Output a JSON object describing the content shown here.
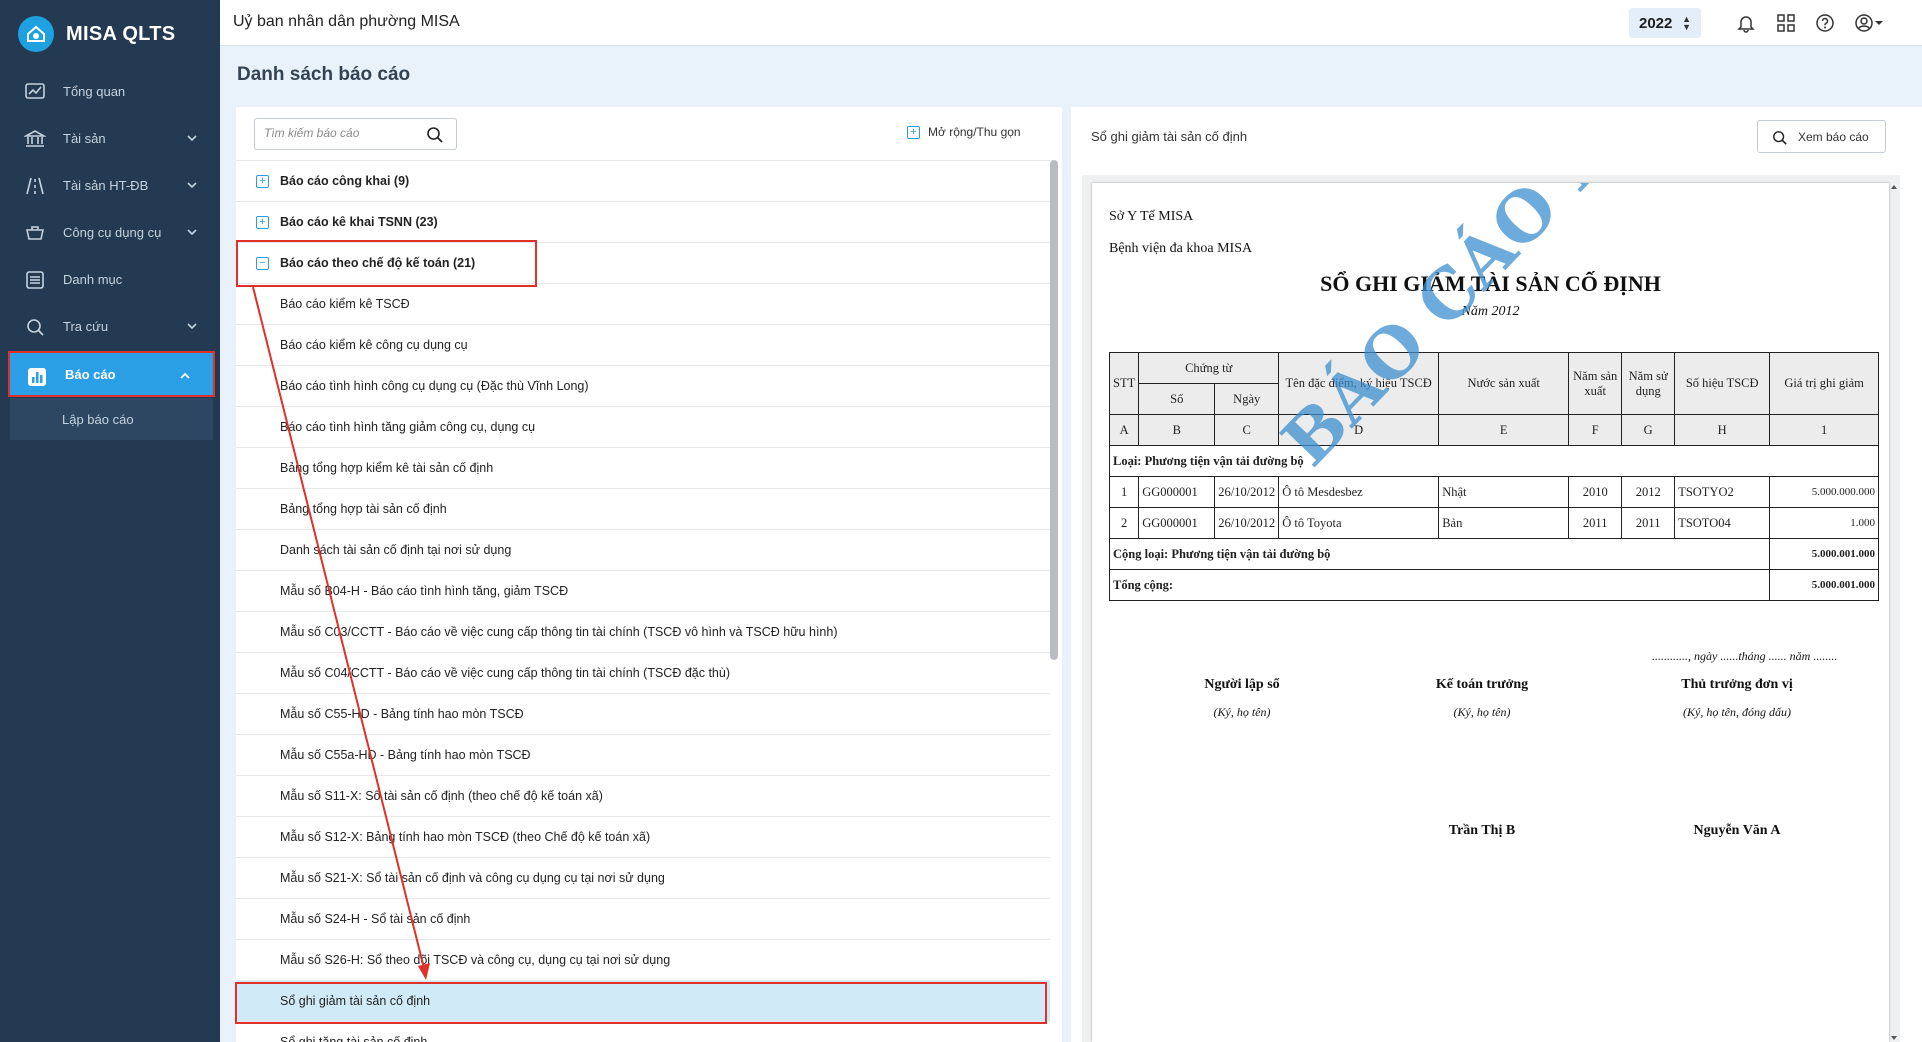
{
  "app": {
    "name": "MISA QLTS",
    "org": "Uỷ ban nhân dân phường MISA",
    "year": "2022"
  },
  "sidebar": {
    "items": [
      {
        "label": "Tổng quan",
        "icon": "chart-line-icon"
      },
      {
        "label": "Tài sản",
        "icon": "bank-icon"
      },
      {
        "label": "Tài sản HT-ĐB",
        "icon": "road-icon"
      },
      {
        "label": "Công cụ dụng cụ",
        "icon": "tools-icon"
      },
      {
        "label": "Danh mục",
        "icon": "list-icon"
      },
      {
        "label": "Tra cứu",
        "icon": "search-icon"
      },
      {
        "label": "Báo cáo",
        "icon": "bar-chart-icon"
      }
    ],
    "sub_item": "Lập báo cáo"
  },
  "page": {
    "title": "Danh sách báo cáo"
  },
  "left": {
    "search_placeholder": "Tìm kiếm báo cáo",
    "expand_label": "Mở rộng/Thu gọn",
    "groups": [
      "Báo cáo công khai (9)",
      "Báo cáo kê khai TSNN (23)",
      "Báo cáo theo chế độ kế toán (21)"
    ],
    "items": [
      "Báo cáo kiểm kê TSCĐ",
      "Báo cáo kiểm kê công cụ dụng cụ",
      "Báo cáo tình hình công cụ dụng cụ (Đặc thù Vĩnh Long)",
      "Báo cáo tình hình tăng giảm công cụ, dụng cụ",
      "Bảng tổng hợp kiểm kê tài sản cố định",
      "Bảng tổng hợp tài sản cố định",
      "Danh sách tài sản cố định tại nơi sử dụng",
      "Mẫu số B04-H - Báo cáo tình hình tăng, giảm TSCĐ",
      "Mẫu số C03/CCTT - Báo cáo về việc cung cấp thông tin tài chính (TSCĐ vô hình và TSCĐ hữu hình)",
      "Mẫu số C04/CCTT - Báo cáo về việc cung cấp thông tin tài chính (TSCĐ đặc thù)",
      "Mẫu số C55-HD - Bảng tính hao mòn TSCĐ",
      "Mẫu số C55a-HD - Bảng tính hao mòn TSCĐ",
      "Mẫu số S11-X: Sổ tài sản cố định (theo chế độ kế toán xã)",
      "Mẫu số S12-X: Bảng tính hao mòn TSCĐ (theo Chế độ kế toán xã)",
      "Mẫu số S21-X: Sổ tài sản cố định và công cụ dụng cụ tại nơi sử dụng",
      "Mẫu số S24-H - Sổ tài sản cố định",
      "Mẫu số S26-H: Sổ theo dõi TSCĐ và công cụ, dụng cụ tại nơi sử dụng",
      "Sổ ghi giảm tài sản cố định",
      "Sổ ghi tăng tài sản cố định"
    ]
  },
  "right": {
    "title": "Sổ ghi giảm tài sản cố định",
    "view_button": "Xem báo cáo",
    "report": {
      "org1": "Sở Y Tế MISA",
      "org2": "Bệnh viện đa khoa MISA",
      "title": "SỔ GHI GIẢM TÀI SẢN CỐ ĐỊNH",
      "subtitle": "Năm 2012",
      "watermark": "BÁO CÁO MẪU",
      "headers": {
        "stt": "STT",
        "chung_tu": "Chứng từ",
        "so": "Số",
        "ngay": "Ngày",
        "ten": "Tên đặc điểm, ký hiệu TSCĐ",
        "nuoc": "Nước sản xuất",
        "nam_sx": "Năm sản xuất",
        "nam_sd": "Năm sử dụng",
        "so_hieu": "Số hiệu TSCĐ",
        "gia_tri": "Giá trị ghi giảm"
      },
      "codes": [
        "A",
        "B",
        "C",
        "D",
        "E",
        "F",
        "G",
        "H",
        "1"
      ],
      "group_label": "Loại: Phương tiện vận tải đường bộ",
      "rows": [
        {
          "stt": "1",
          "so": "GG000001",
          "ngay": "26/10/2012",
          "ten": "Ô tô Mesdesbez",
          "nuoc": "Nhật",
          "nam_sx": "2010",
          "nam_sd": "2012",
          "so_hieu": "TSOTYO2",
          "gia_tri": "5.000.000.000"
        },
        {
          "stt": "2",
          "so": "GG000001",
          "ngay": "26/10/2012",
          "ten": "Ô tô Toyota",
          "nuoc": "Bản",
          "nam_sx": "2011",
          "nam_sd": "2011",
          "so_hieu": "TSOTO04",
          "gia_tri": "1.000"
        }
      ],
      "subtotal_label": "Cộng loại: Phương tiện vận tải đường bộ",
      "subtotal_value": "5.000.001.000",
      "total_label": "Tổng cộng:",
      "total_value": "5.000.001.000",
      "date_line": "............, ngày ......tháng ...... năm ........",
      "signers": [
        {
          "role": "Người lập sổ",
          "note": "(Ký, họ tên)",
          "name": ""
        },
        {
          "role": "Kế toán trưởng",
          "note": "(Ký, họ tên)",
          "name": "Trần Thị B"
        },
        {
          "role": "Thủ trưởng đơn vị",
          "note": "(Ký, họ tên, đóng dấu)",
          "name": "Nguyễn Văn A"
        }
      ]
    }
  },
  "colors": {
    "sidebar": "#243a52",
    "accent": "#2a9fe6",
    "highlight": "#e0302a",
    "selected_row": "#d0ebf7"
  }
}
